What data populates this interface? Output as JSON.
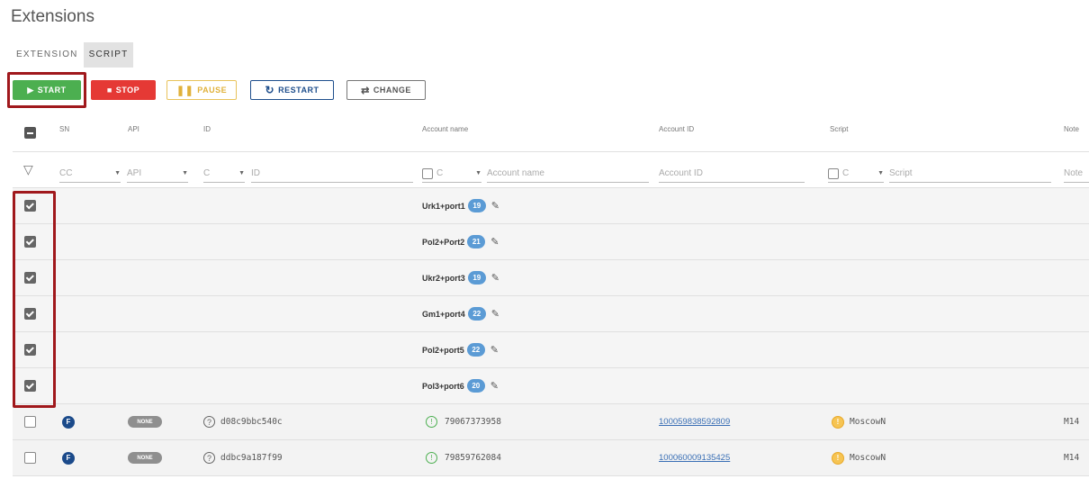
{
  "page": {
    "title": "Extensions"
  },
  "tabs": [
    {
      "label": "EXTENSION",
      "active": false
    },
    {
      "label": "SCRIPT",
      "active": true
    }
  ],
  "toolbar": {
    "start": "START",
    "stop": "STOP",
    "pause": "PAUSE",
    "restart": "RESTART",
    "change": "CHANGE"
  },
  "columns": {
    "sn": "SN",
    "api": "API",
    "id": "ID",
    "account_name": "Account name",
    "account_id": "Account ID",
    "script": "Script",
    "note": "Note"
  },
  "filters": {
    "sn": "CC",
    "api": "API",
    "id_mode": "C",
    "id": "ID",
    "account_name_mode": "C",
    "account_name": "Account name",
    "account_id": "Account ID",
    "script_mode": "C",
    "script": "Script",
    "note": "Note"
  },
  "groups": [
    {
      "name": "Urk1+port1",
      "count": "19",
      "checked": true
    },
    {
      "name": "Pol2+Port2",
      "count": "21",
      "checked": true
    },
    {
      "name": "Ukr2+port3",
      "count": "19",
      "checked": true
    },
    {
      "name": "Gm1+port4",
      "count": "22",
      "checked": true
    },
    {
      "name": "Pol2+port5",
      "count": "22",
      "checked": true
    },
    {
      "name": "Pol3+port6",
      "count": "20",
      "checked": true
    }
  ],
  "rows": [
    {
      "sn_icon": "F",
      "api": "NONE",
      "id": "d08c9bbc540c",
      "account_name": "79067373958",
      "account_id": "100059838592809",
      "script": "MoscowN",
      "note": "M14"
    },
    {
      "sn_icon": "F",
      "api": "NONE",
      "id": "ddbc9a187f99",
      "account_name": "79859762084",
      "account_id": "100060009135425",
      "script": "MoscowN",
      "note": "M14"
    }
  ],
  "colors": {
    "start": "#4caf50",
    "stop": "#e53935",
    "pause": "#e0b13a",
    "restart": "#1e4e8c",
    "highlight": "#a0181c",
    "badge": "#5b9bd5"
  }
}
